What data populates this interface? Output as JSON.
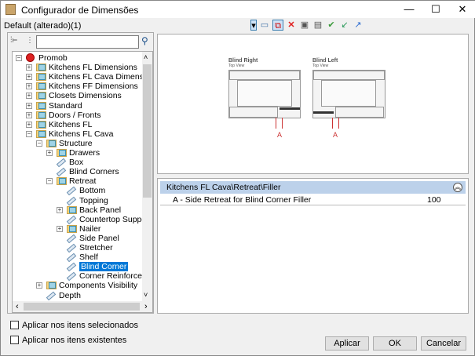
{
  "window": {
    "title": "Configurador de Dimensões",
    "minimize": "—",
    "maximize": "☐",
    "close": "✕"
  },
  "profile": "Default (alterado)(1)",
  "search": {
    "value": "",
    "placeholder": ""
  },
  "tree": [
    {
      "label": "Promob",
      "level": 0,
      "type": "root",
      "exp": "-"
    },
    {
      "label": "Kitchens FL Dimensions",
      "level": 1,
      "type": "folder",
      "exp": "+"
    },
    {
      "label": "Kitchens FL Cava Dimensions",
      "level": 1,
      "type": "folder",
      "exp": "+"
    },
    {
      "label": "Kitchens FF Dimensions",
      "level": 1,
      "type": "folder",
      "exp": "+"
    },
    {
      "label": "Closets Dimensions",
      "level": 1,
      "type": "folder",
      "exp": "+"
    },
    {
      "label": "Standard",
      "level": 1,
      "type": "folder",
      "exp": "+"
    },
    {
      "label": "Doors / Fronts",
      "level": 1,
      "type": "folder",
      "exp": "+"
    },
    {
      "label": "Kitchens FL",
      "level": 1,
      "type": "folder",
      "exp": "+"
    },
    {
      "label": "Kitchens FL Cava",
      "level": 1,
      "type": "folder",
      "exp": "-"
    },
    {
      "label": "Structure",
      "level": 2,
      "type": "folder",
      "exp": "-"
    },
    {
      "label": "Drawers",
      "level": 3,
      "type": "folder",
      "exp": "+"
    },
    {
      "label": "Box",
      "level": 3,
      "type": "doc",
      "exp": ""
    },
    {
      "label": "Blind Corners",
      "level": 3,
      "type": "doc",
      "exp": ""
    },
    {
      "label": "Retreat",
      "level": 3,
      "type": "folder",
      "exp": "-"
    },
    {
      "label": "Bottom",
      "level": 4,
      "type": "doc",
      "exp": ""
    },
    {
      "label": "Topping",
      "level": 4,
      "type": "doc",
      "exp": ""
    },
    {
      "label": "Back Panel",
      "level": 4,
      "type": "folder",
      "exp": "+"
    },
    {
      "label": "Countertop Support",
      "level": 4,
      "type": "doc",
      "exp": ""
    },
    {
      "label": "Nailer",
      "level": 4,
      "type": "folder",
      "exp": "+"
    },
    {
      "label": "Side Panel",
      "level": 4,
      "type": "doc",
      "exp": ""
    },
    {
      "label": "Stretcher",
      "level": 4,
      "type": "doc",
      "exp": ""
    },
    {
      "label": "Shelf",
      "level": 4,
      "type": "doc",
      "exp": ""
    },
    {
      "label": "Blind Corner",
      "level": 4,
      "type": "doc",
      "exp": "",
      "selected": true
    },
    {
      "label": "Corner Reinforcement",
      "level": 4,
      "type": "doc",
      "exp": ""
    },
    {
      "label": "Components Visibility",
      "level": 2,
      "type": "folder",
      "exp": "+"
    },
    {
      "label": "Depth",
      "level": 2,
      "type": "doc",
      "exp": ""
    }
  ],
  "preview": {
    "right_title": "Blind Right",
    "right_sub": "Top View",
    "left_title": "Blind Left",
    "left_sub": "Top View",
    "dim_label": "A"
  },
  "properties": {
    "category": "Kitchens FL Cava\\Retreat\\Filler",
    "rows": [
      {
        "name": "A - Side Retreat for Blind Corner Filler",
        "value": "100"
      }
    ]
  },
  "options": {
    "apply_selected": "Aplicar nos itens selecionados",
    "apply_existing": "Aplicar nos itens existentes"
  },
  "buttons": {
    "apply": "Aplicar",
    "ok": "OK",
    "cancel": "Cancelar"
  }
}
